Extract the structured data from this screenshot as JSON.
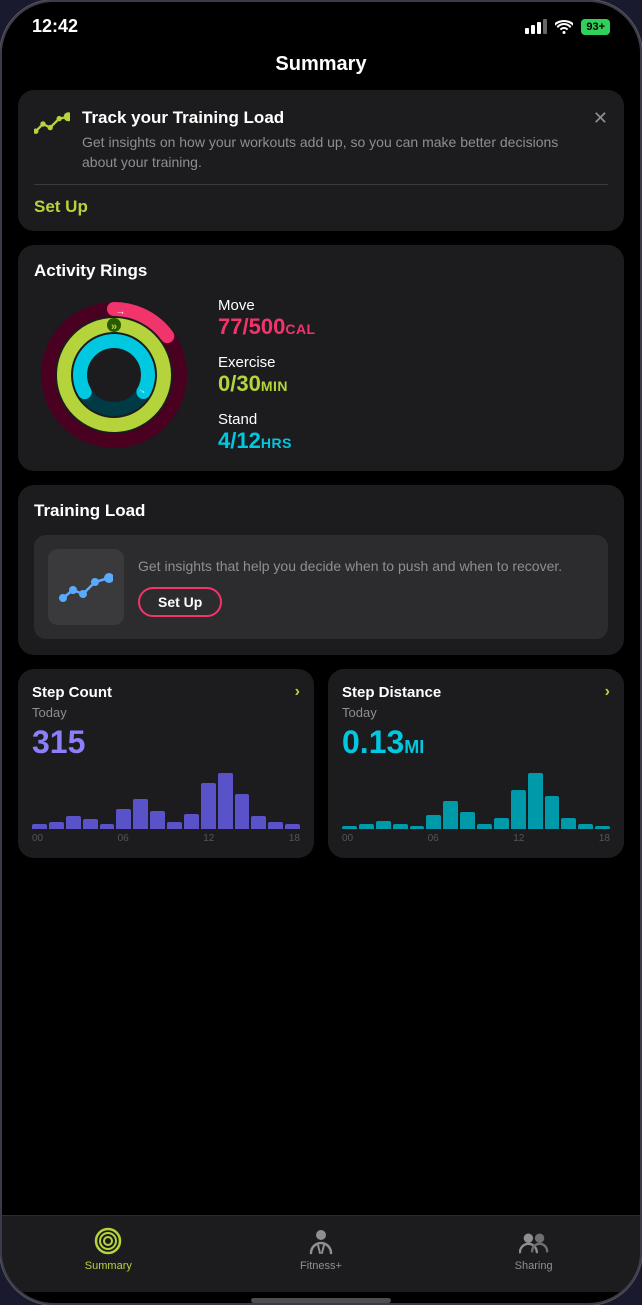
{
  "status": {
    "time": "12:42",
    "battery": "93+"
  },
  "page": {
    "title": "Summary"
  },
  "promo_card": {
    "title": "Track your Training Load",
    "description": "Get insights on how your workouts add up, so you can make better decisions about your training.",
    "setup_label": "Set Up"
  },
  "activity_rings": {
    "section_title": "Activity Rings",
    "move_label": "Move",
    "move_current": "77",
    "move_goal": "500",
    "move_unit": "CAL",
    "exercise_label": "Exercise",
    "exercise_current": "0",
    "exercise_goal": "30",
    "exercise_unit": "MIN",
    "stand_label": "Stand",
    "stand_current": "4",
    "stand_goal": "12",
    "stand_unit": "HRS"
  },
  "training_load": {
    "section_title": "Training Load",
    "description": "Get insights that help you decide when to push and when to recover.",
    "setup_label": "Set Up"
  },
  "step_count": {
    "title": "Step Count",
    "sublabel": "Today",
    "value": "315",
    "chart_labels": [
      "00",
      "06",
      "12",
      "18"
    ],
    "bars": [
      2,
      3,
      5,
      4,
      2,
      8,
      12,
      7,
      3,
      6,
      18,
      22,
      14,
      5,
      3,
      2
    ]
  },
  "step_distance": {
    "title": "Step Distance",
    "sublabel": "Today",
    "value": "0.13",
    "unit": "MI",
    "chart_labels": [
      "00",
      "06",
      "12",
      "18"
    ],
    "bars": [
      1,
      2,
      3,
      2,
      1,
      5,
      10,
      6,
      2,
      4,
      14,
      20,
      12,
      4,
      2,
      1
    ]
  },
  "nav": {
    "summary_label": "Summary",
    "fitness_label": "Fitness+",
    "sharing_label": "Sharing"
  }
}
